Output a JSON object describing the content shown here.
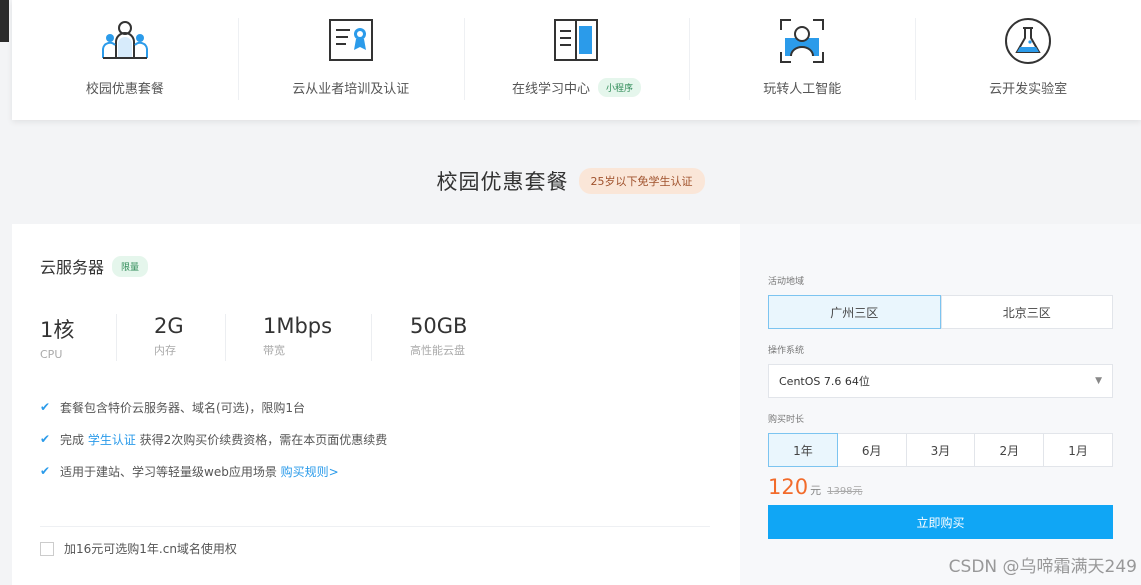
{
  "nav": [
    {
      "label": "校园优惠套餐",
      "icon": "people-icon"
    },
    {
      "label": "云从业者培训及认证",
      "icon": "certificate-icon"
    },
    {
      "label": "在线学习中心",
      "icon": "book-icon",
      "badge": "小程序"
    },
    {
      "label": "玩转人工智能",
      "icon": "face-scan-icon"
    },
    {
      "label": "云开发实验室",
      "icon": "flask-icon"
    }
  ],
  "section": {
    "title": "校园优惠套餐",
    "badge": "25岁以下免学生认证"
  },
  "product": {
    "title": "云服务器",
    "badge": "限量",
    "specs": [
      {
        "value": "1核",
        "label": "CPU"
      },
      {
        "value": "2G",
        "label": "内存"
      },
      {
        "value": "1Mbps",
        "label": "带宽"
      },
      {
        "value": "50GB",
        "label": "高性能云盘"
      }
    ],
    "features": {
      "f1": "套餐包含特价云服务器、域名(可选)，限购1台",
      "f2_pre": "完成 ",
      "f2_link": "学生认证",
      "f2_post": " 获得2次购买价续费资格，需在本页面优惠续费",
      "f3_pre": "适用于建站、学习等轻量级web应用场景 ",
      "f3_link": "购买规则>"
    },
    "domain_option": "加16元可选购1年.cn域名使用权"
  },
  "purchase": {
    "region_label": "活动地域",
    "regions": [
      "广州三区",
      "北京三区"
    ],
    "os_label": "操作系统",
    "os_value": "CentOS 7.6 64位",
    "duration_label": "购买时长",
    "durations": [
      "1年",
      "6月",
      "3月",
      "2月",
      "1月"
    ],
    "price": "120",
    "price_unit": "元",
    "old_price": "1398元",
    "buy_label": "立即购买"
  },
  "watermark": "CSDN @乌啼霜满天249",
  "colors": {
    "accent": "#10a6f5",
    "price": "#f26b2b",
    "link": "#2b9bea",
    "badge_green": "#2e8b57"
  }
}
